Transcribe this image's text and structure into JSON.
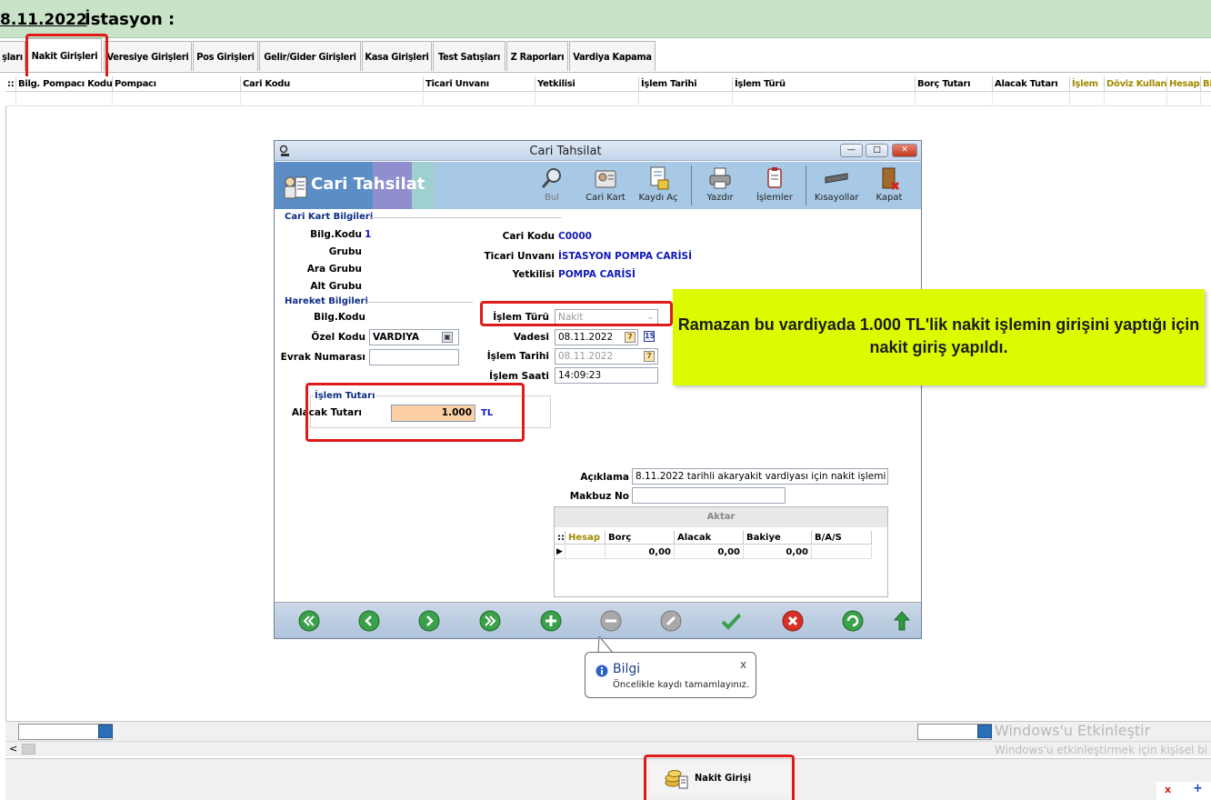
{
  "header": {
    "date": "8.11.2022",
    "station_label": "İstasyon :"
  },
  "tabs": [
    {
      "label": "şları"
    },
    {
      "label": "Nakit Girişleri",
      "active": true
    },
    {
      "label": "Veresiye Girişleri"
    },
    {
      "label": "Pos Girişleri"
    },
    {
      "label": "Gelir/Gider Girişleri"
    },
    {
      "label": "Kasa Girişleri"
    },
    {
      "label": "Test Satışları"
    },
    {
      "label": "Z Raporları"
    },
    {
      "label": "Vardiya Kapama"
    }
  ],
  "grid": {
    "columns": [
      "Bilg. Pompacı Kodu",
      "Pompacı",
      "Cari Kodu",
      "Ticari Unvanı",
      "Yetkilisi",
      "İşlem Tarihi",
      "İşlem Türü",
      "Borç Tutarı",
      "Alacak Tutarı",
      "İşlem",
      "Döviz Kullan",
      "Hesap",
      "Bi"
    ]
  },
  "modal": {
    "window_title": "Cari Tahsilat",
    "header_title": "Cari Tahsilat",
    "toolbar": [
      {
        "label": "Bul",
        "icon": "search-icon"
      },
      {
        "label": "Cari Kart",
        "icon": "card-icon"
      },
      {
        "label": "Kaydı Aç",
        "icon": "unlock-record-icon"
      },
      {
        "label": "Yazdır",
        "icon": "printer-icon"
      },
      {
        "label": "İşlemler",
        "icon": "clipboard-icon"
      },
      {
        "label": "Kısayollar",
        "icon": "keyboard-icon"
      },
      {
        "label": "Kapat",
        "icon": "exit-door-icon"
      }
    ],
    "cari_kart_section": "Cari Kart Bilgileri",
    "labels": {
      "bilg_kodu": "Bilg.Kodu",
      "grubu": "Grubu",
      "ara_grubu": "Ara Grubu",
      "alt_grubu": "Alt Grubu",
      "cari_kodu": "Cari Kodu",
      "ticari_unvani": "Ticari Unvanı",
      "yetkilisi": "Yetkilisi",
      "hareket_bilg_kodu": "Bilg.Kodu",
      "ozel_kodu": "Özel Kodu",
      "evrak_numarasi": "Evrak Numarası",
      "islem_turu": "İşlem Türü",
      "vadesi": "Vadesi",
      "islem_tarihi": "İşlem Tarihi",
      "islem_saati": "İşlem Saati",
      "islem_tutari": "İşlem Tutarı",
      "alacak_tutari": "Alacak Tutarı",
      "aciklama": "Açıklama",
      "makbuz_no": "Makbuz No"
    },
    "values": {
      "bilg_kodu": "1",
      "cari_kodu": "C0000",
      "ticari_unvani": "İSTASYON POMPA CARİSİ",
      "yetkilisi": "POMPA CARİSİ",
      "ozel_kodu": "VARDIYA",
      "evrak_numarasi": "",
      "islem_turu": "Nakit",
      "vadesi": "08.11.2022",
      "islem_tarihi": "08.11.2022",
      "islem_saati": "14:09:23",
      "alacak_tutari": "1.000",
      "currency": "TL",
      "aciklama": "8.11.2022 tarihli akaryakit vardiyası için nakit işlemi",
      "makbuz_no": ""
    },
    "hareket_section": "Hareket Bilgileri",
    "aktar": {
      "title": "Aktar",
      "columns": [
        "Hesap",
        "Borç",
        "Alacak",
        "Bakiye",
        "B/A/S"
      ],
      "row": [
        "",
        "0,00",
        "0,00",
        "0,00",
        ""
      ]
    }
  },
  "callout": {
    "text": "Ramazan bu vardiyada 1.000 TL'lik nakit işlemin girişini yaptığı için nakit giriş yapıldı."
  },
  "tooltip": {
    "title": "Bilgi",
    "message": "Öncelikle kaydı tamamlayınız.",
    "close": "x"
  },
  "bottom": {
    "nakit_button": "Nakit Girişi",
    "watermark_title": "Windows'u Etkinleştir",
    "watermark_sub": "Windows'u etkinleştirmek için kişisel bi",
    "scroll_left": "<",
    "tray_x": "x",
    "tray_plus": "+"
  },
  "colors": {
    "header_bg": "#c8e3c8",
    "callout_bg": "#dcfb00",
    "highlight": "#e01a1a",
    "value_blue": "#1019b6",
    "amount_bg": "#fdd0a3"
  }
}
